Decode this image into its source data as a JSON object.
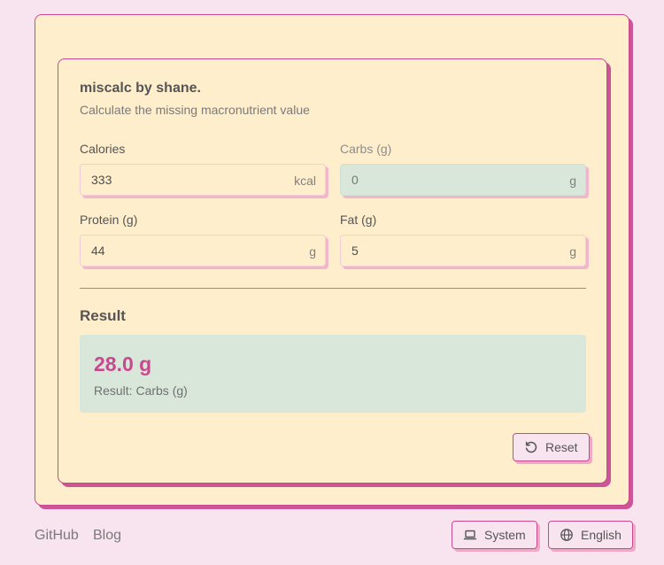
{
  "app": {
    "title": "miscalc by shane.",
    "subtitle": "Calculate the missing macronutrient value"
  },
  "fields": {
    "calories": {
      "label": "Calories",
      "value": "333",
      "unit": "kcal"
    },
    "carbs": {
      "label": "Carbs (g)",
      "placeholder": "0",
      "unit": "g"
    },
    "protein": {
      "label": "Protein (g)",
      "value": "44",
      "unit": "g"
    },
    "fat": {
      "label": "Fat (g)",
      "value": "5",
      "unit": "g"
    }
  },
  "result": {
    "heading": "Result",
    "value": "28.0 g",
    "caption": "Result: Carbs (g)"
  },
  "reset": {
    "label": "Reset",
    "icon": "reset-icon"
  },
  "footer": {
    "links": [
      "GitHub",
      "Blog"
    ],
    "theme": {
      "label": "System",
      "icon": "laptop-icon"
    },
    "language": {
      "label": "English",
      "icon": "globe-icon"
    }
  },
  "colors": {
    "background": "#f8e4ee",
    "card": "#ffeecb",
    "accent": "#c9498f",
    "result_bg": "#d8e7da"
  }
}
